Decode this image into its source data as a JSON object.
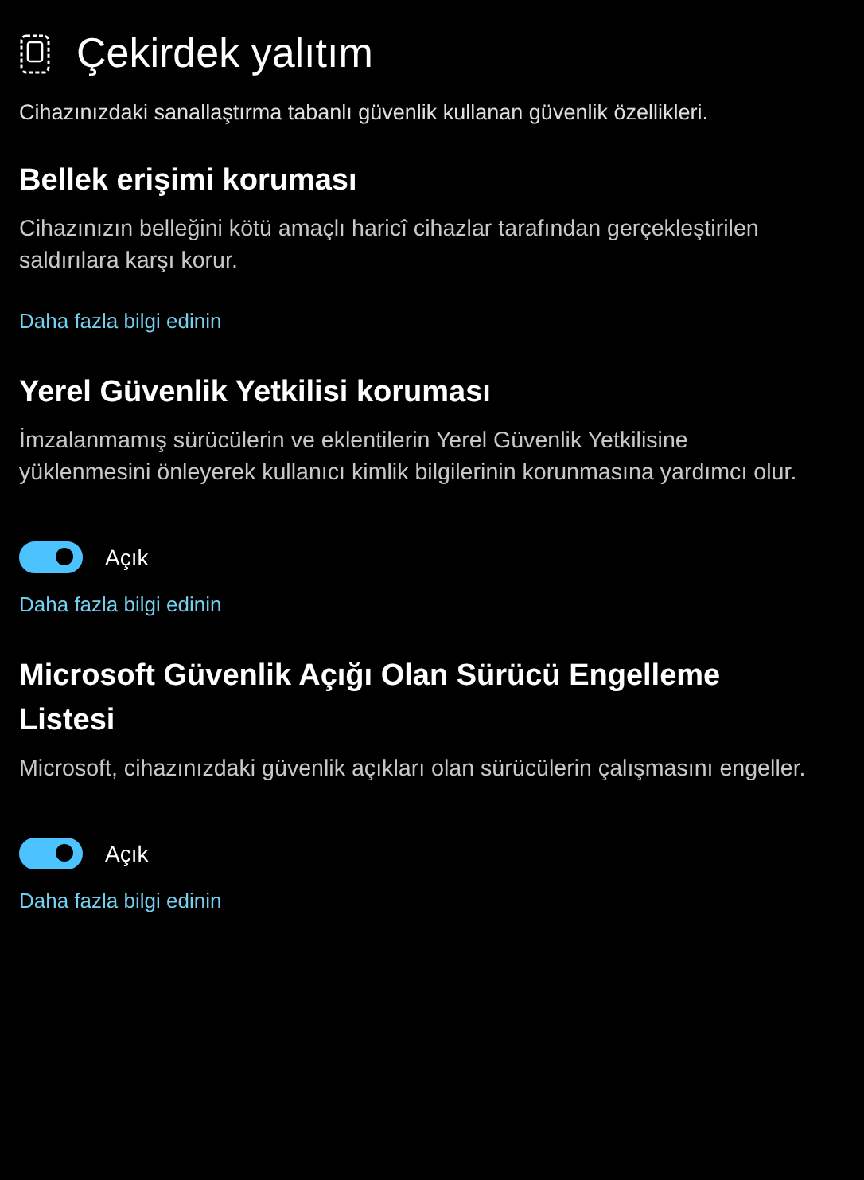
{
  "header": {
    "title": "Çekirdek yalıtım",
    "subtitle": "Cihazınızdaki sanallaştırma tabanlı güvenlik kullanan güvenlik özellikleri."
  },
  "sections": [
    {
      "title": "Bellek erişimi koruması",
      "description": "Cihazınızın belleğini kötü amaçlı haricî cihazlar tarafından gerçekleştirilen saldırılara karşı korur.",
      "link": "Daha fazla bilgi edinin"
    },
    {
      "title": "Yerel Güvenlik Yetkilisi koruması",
      "description": "İmzalanmamış sürücülerin ve eklentilerin Yerel Güvenlik Yetkilisine yüklenmesini önleyerek kullanıcı kimlik bilgilerinin korunmasına yardımcı olur.",
      "toggle": {
        "on": true,
        "label": "Açık"
      },
      "link": "Daha fazla bilgi edinin"
    },
    {
      "title": "Microsoft Güvenlik Açığı Olan Sürücü Engelleme Listesi",
      "description": "Microsoft, cihazınızdaki güvenlik açıkları olan sürücülerin çalışmasını engeller.",
      "toggle": {
        "on": true,
        "label": "Açık"
      },
      "link": "Daha fazla bilgi edinin"
    }
  ]
}
